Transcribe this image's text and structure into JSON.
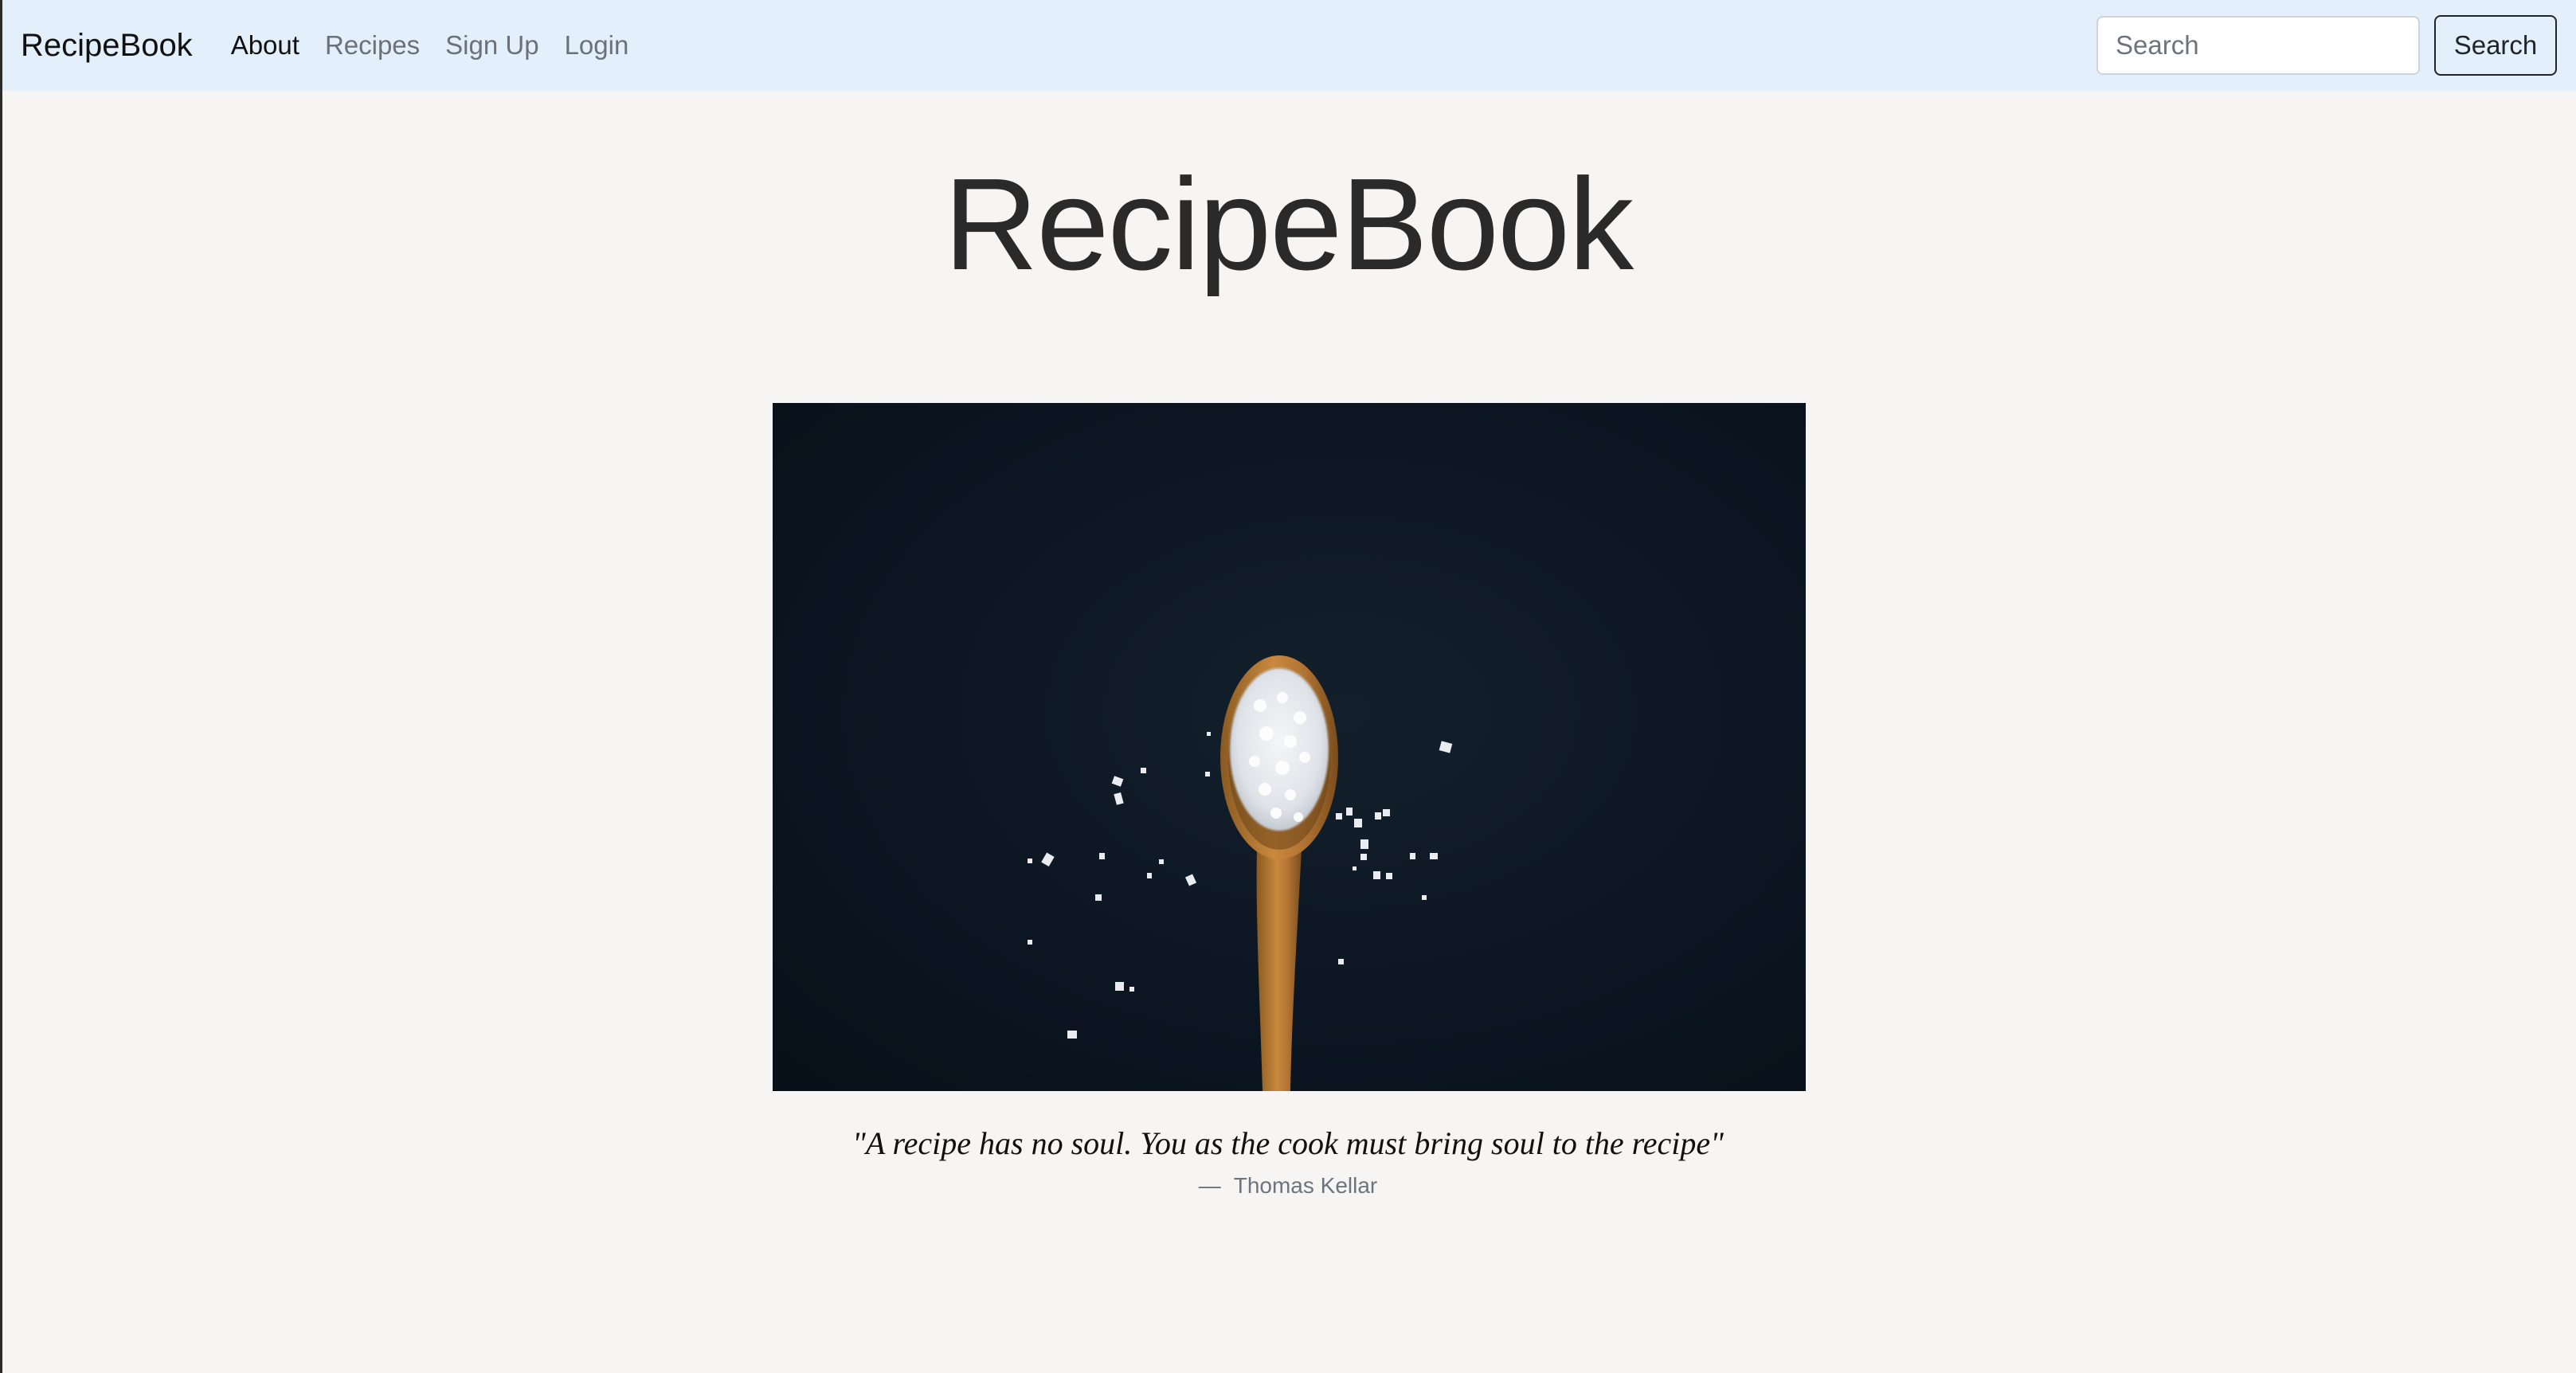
{
  "navbar": {
    "brand": "RecipeBook",
    "links": [
      {
        "label": "About",
        "active": true
      },
      {
        "label": "Recipes",
        "active": false
      },
      {
        "label": "Sign Up",
        "active": false
      },
      {
        "label": "Login",
        "active": false
      }
    ],
    "search": {
      "placeholder": "Search",
      "value": "",
      "button_label": "Search"
    },
    "background_color": "#e3f0fb"
  },
  "main": {
    "title": "RecipeBook",
    "hero_image": {
      "alt": "wooden spoon with coarse salt on dark background"
    },
    "quote": {
      "text": "\"A recipe has no soul. You as the cook must bring soul to the recipe\"",
      "dash": "—",
      "author": "Thomas Kellar"
    }
  },
  "colors": {
    "page_background": "#f6f5f3",
    "text": "#212529",
    "muted": "#6c757d"
  }
}
